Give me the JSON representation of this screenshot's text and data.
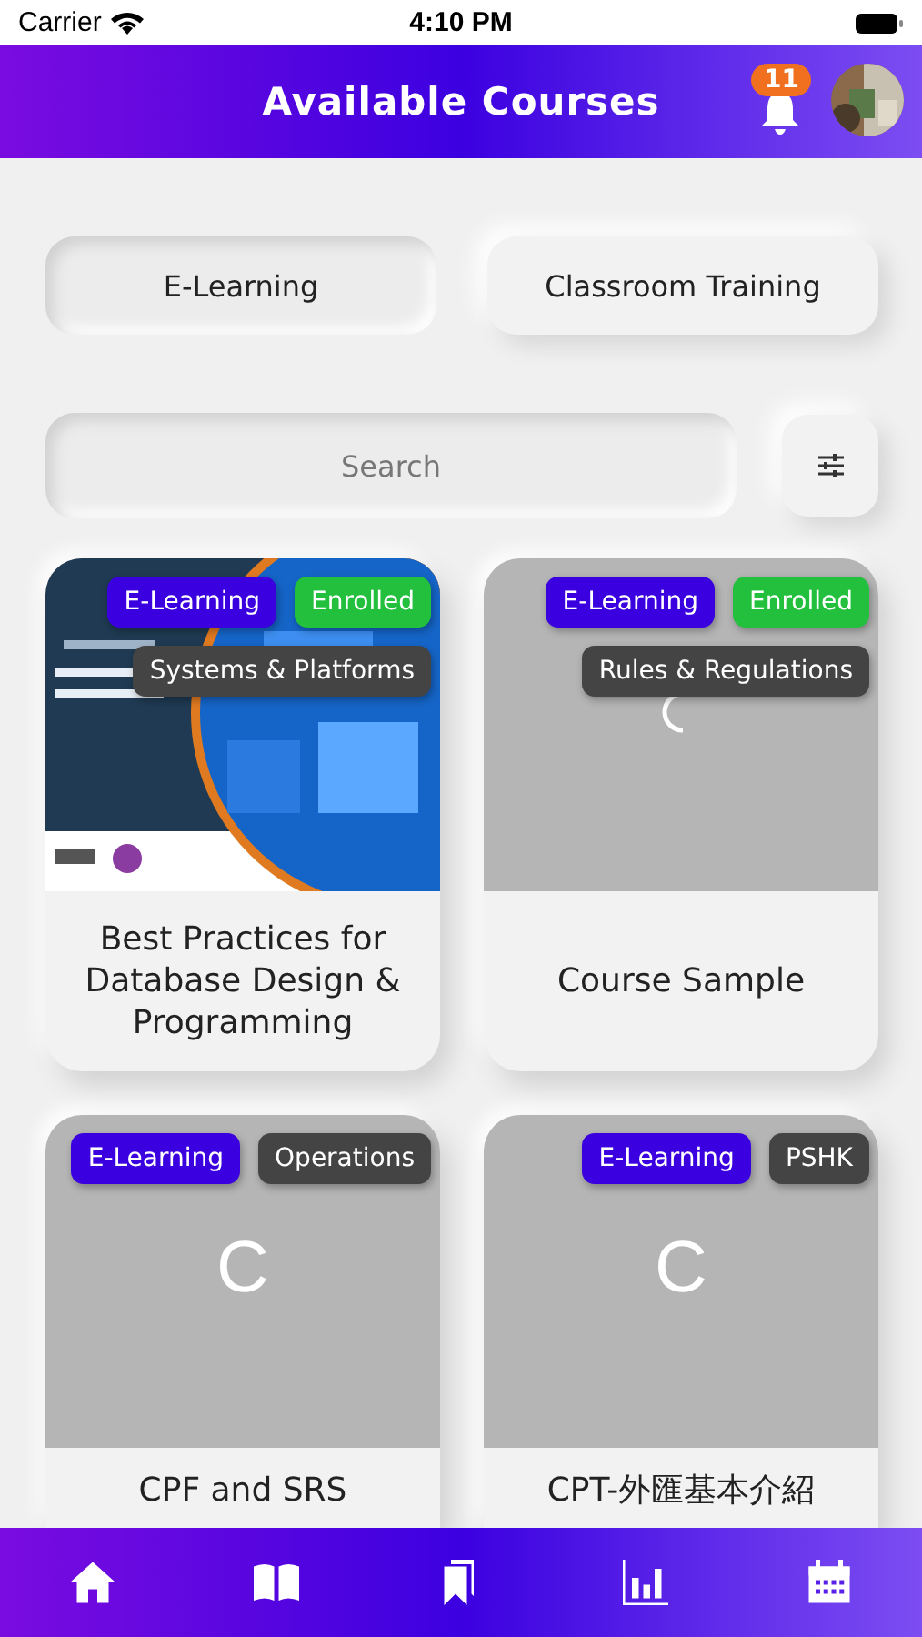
{
  "status_bar": {
    "carrier": "Carrier",
    "time": "4:10 PM"
  },
  "header": {
    "title": "Available Courses",
    "notifications": "11"
  },
  "filters": [
    {
      "label": "E-Learning",
      "selected": true
    },
    {
      "label": "Classroom Training",
      "selected": false
    }
  ],
  "search": {
    "placeholder": "Search"
  },
  "courses": [
    {
      "title": "Best Practices for Database Design & Programming",
      "image": {
        "kind": "picture"
      },
      "tags": [
        {
          "label": "E-Learning",
          "color": "#3a00e0"
        },
        {
          "label": "Enrolled",
          "color": "#22c03c"
        },
        {
          "label": "Systems & Platforms",
          "color": "#444444"
        }
      ]
    },
    {
      "title": "Course Sample",
      "image": {
        "kind": "loading"
      },
      "tags": [
        {
          "label": "E-Learning",
          "color": "#3a00e0"
        },
        {
          "label": "Enrolled",
          "color": "#22c03c"
        },
        {
          "label": "Rules & Regulations",
          "color": "#444444"
        }
      ]
    },
    {
      "title": "CPF and SRS",
      "image": {
        "kind": "letter",
        "letter": "C"
      },
      "tags": [
        {
          "label": "E-Learning",
          "color": "#3a00e0"
        },
        {
          "label": "Operations",
          "color": "#444444"
        }
      ]
    },
    {
      "title": "CPT-外匯基本介紹",
      "image": {
        "kind": "letter",
        "letter": "C"
      },
      "tags": [
        {
          "label": "E-Learning",
          "color": "#3a00e0"
        },
        {
          "label": "PSHK",
          "color": "#444444"
        }
      ]
    }
  ]
}
